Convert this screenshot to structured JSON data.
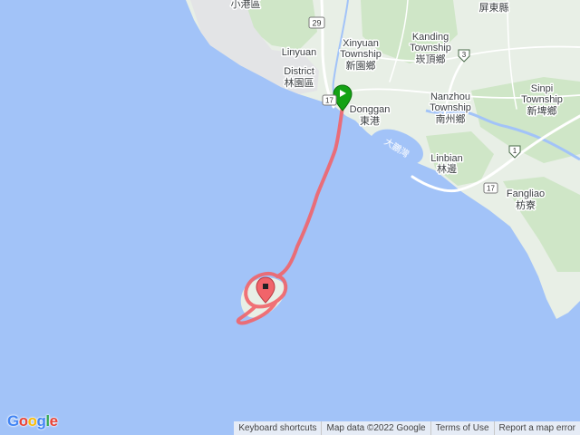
{
  "colors": {
    "sea": "#a2c3f8",
    "land": "#e8efe6",
    "green_area": "#cfe6c7",
    "urban": "#e3e4e6",
    "road_highway": "#ffffff",
    "river": "#a2c3f8",
    "track": "#f1646a",
    "start_marker": "#14a214",
    "logo_blue": "#4285f4",
    "logo_red": "#ea4335",
    "logo_yellow": "#fbbc05",
    "logo_green": "#34a853"
  },
  "places": [
    {
      "id": "xiaogang",
      "text": "小港區"
    },
    {
      "id": "pingtung",
      "text": "屏東縣"
    },
    {
      "id": "xinyuan_en1",
      "text": "Xinyuan"
    },
    {
      "id": "xinyuan_en2",
      "text": "Township"
    },
    {
      "id": "xinyuan_zh",
      "text": "新園鄉"
    },
    {
      "id": "kanding_en1",
      "text": "Kanding"
    },
    {
      "id": "kanding_en2",
      "text": "Township"
    },
    {
      "id": "kanding_zh",
      "text": "崁頂鄉"
    },
    {
      "id": "linyuan_en1",
      "text": "Linyuan"
    },
    {
      "id": "linyuan_en2",
      "text": "District"
    },
    {
      "id": "linyuan_zh",
      "text": "林園區"
    },
    {
      "id": "donggan_en",
      "text": "Donggan"
    },
    {
      "id": "donggan_zh",
      "text": "東港"
    },
    {
      "id": "nanzhou_en1",
      "text": "Nanzhou"
    },
    {
      "id": "nanzhou_en2",
      "text": "Township"
    },
    {
      "id": "nanzhou_zh",
      "text": "南州鄉"
    },
    {
      "id": "sinpi_en1",
      "text": "Sinpi"
    },
    {
      "id": "sinpi_en2",
      "text": "Township"
    },
    {
      "id": "sinpi_zh",
      "text": "新埤鄉"
    },
    {
      "id": "linbian_en",
      "text": "Linbian"
    },
    {
      "id": "linbian_zh",
      "text": "林邊"
    },
    {
      "id": "fangliao_en",
      "text": "Fangliao"
    },
    {
      "id": "fangliao_zh",
      "text": "枋寮"
    }
  ],
  "water_label": "大鵬灣",
  "shields": [
    {
      "id": "r29",
      "text": "29"
    },
    {
      "id": "r3",
      "text": "3"
    },
    {
      "id": "r1",
      "text": "1"
    },
    {
      "id": "r17a",
      "text": "17"
    },
    {
      "id": "r17b",
      "text": "17"
    }
  ],
  "logo": [
    "G",
    "o",
    "o",
    "g",
    "l",
    "e"
  ],
  "footer": {
    "keyboard_shortcuts": "Keyboard shortcuts",
    "map_data": "Map data ©2022 Google",
    "terms": "Terms of Use",
    "report": "Report a map error"
  }
}
